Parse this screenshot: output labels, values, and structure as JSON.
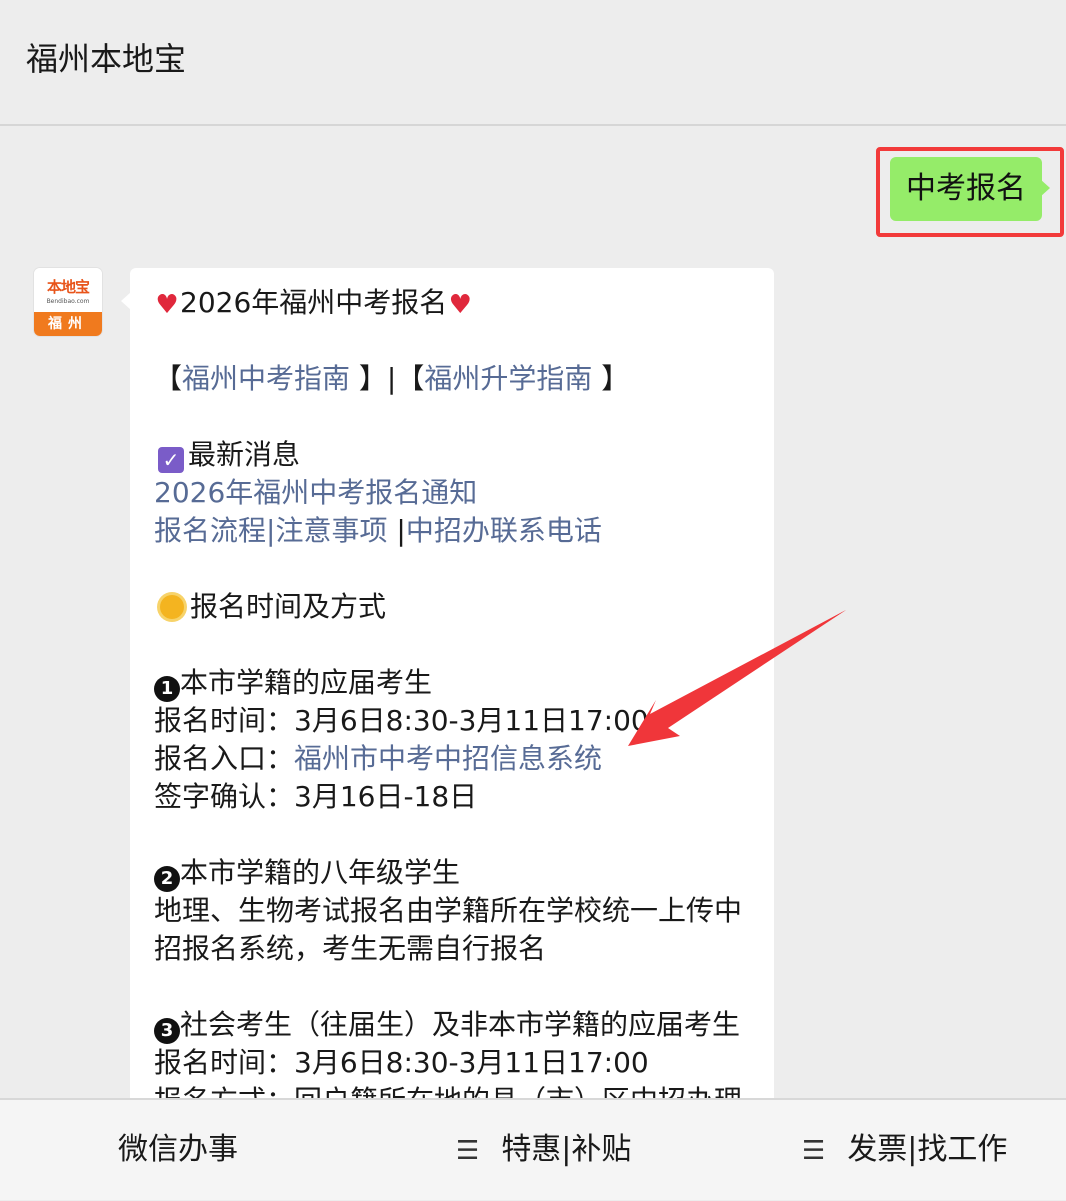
{
  "header": {
    "title": "福州本地宝"
  },
  "sent_message": {
    "text": "中考报名"
  },
  "avatar": {
    "logo_name": "本地宝",
    "logo_url": "Bendibao.com",
    "city": "福州"
  },
  "reply": {
    "title": "2026年福州中考报名",
    "guide_open1": "【",
    "guide_link1": "福州中考指南",
    "guide_sep": " 】|【",
    "guide_link2": "福州升学指南",
    "guide_close": " 】",
    "news_heading": "最新消息",
    "news_link": "2026年福州中考报名通知",
    "links_line": {
      "link1": "报名流程",
      "sep1": "|",
      "link2": "注意事项",
      "sep2": " |",
      "link3": "中招办联系电话"
    },
    "time_heading": "报名时间及方式",
    "section1": {
      "num": "1",
      "title": "本市学籍的应届考生",
      "time": "报名时间：3月6日8:30-3月11日17:00",
      "entry_label": "报名入口：",
      "entry_link": "福州市中考中招信息系统",
      "confirm": "签字确认：3月16日-18日"
    },
    "section2": {
      "num": "2",
      "title": "本市学籍的八年级学生",
      "line1": "地理、生物考试报名由学籍所在学校统一上传中",
      "line2": "招报名系统，考生无需自行报名"
    },
    "section3": {
      "num": "3",
      "title": "社会考生（往届生）及非本市学籍的应届考生",
      "time": "报名时间：3月6日8:30-3月11日17:00",
      "method_partial": "报名方式：回户籍所在地的县（市）区中招办理"
    }
  },
  "bottom_menu": [
    {
      "label": "微信办事",
      "icon": ""
    },
    {
      "label": "特惠|补贴",
      "icon": "☰"
    },
    {
      "label": "发票|找工作",
      "icon": "☰"
    }
  ],
  "colors": {
    "link": "#576b95",
    "sent_bubble": "#95ec69",
    "highlight": "#f23a3a",
    "arrow": "#f0363a"
  }
}
